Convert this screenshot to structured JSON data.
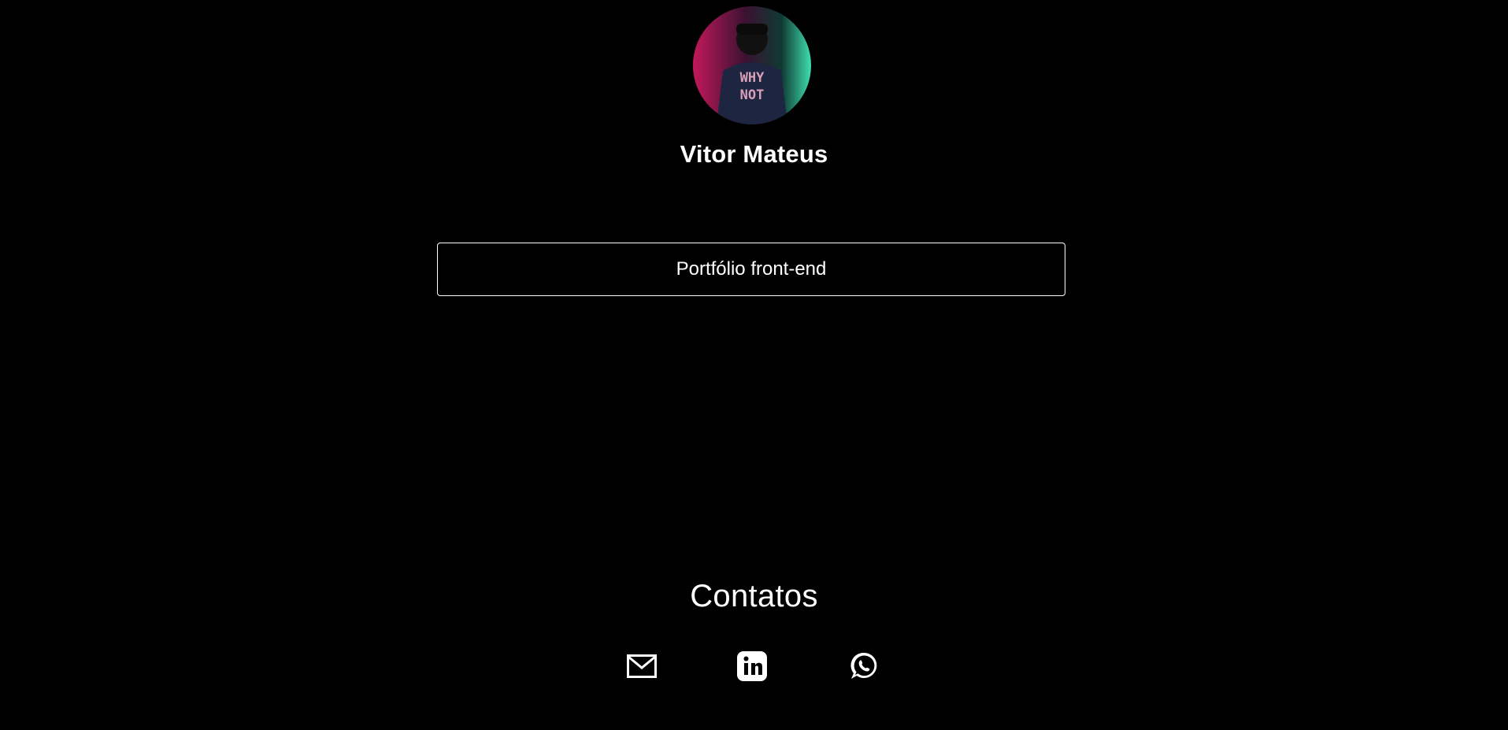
{
  "profile": {
    "name": "Vitor Mateus",
    "avatar_icon": "user-photo-avatar"
  },
  "links": [
    {
      "label": "Portfólio front-end"
    }
  ],
  "contacts": {
    "title": "Contatos",
    "items": [
      {
        "icon": "mail-icon"
      },
      {
        "icon": "linkedin-icon"
      },
      {
        "icon": "whatsapp-icon"
      }
    ]
  },
  "colors": {
    "background": "#000000",
    "foreground": "#ffffff"
  }
}
